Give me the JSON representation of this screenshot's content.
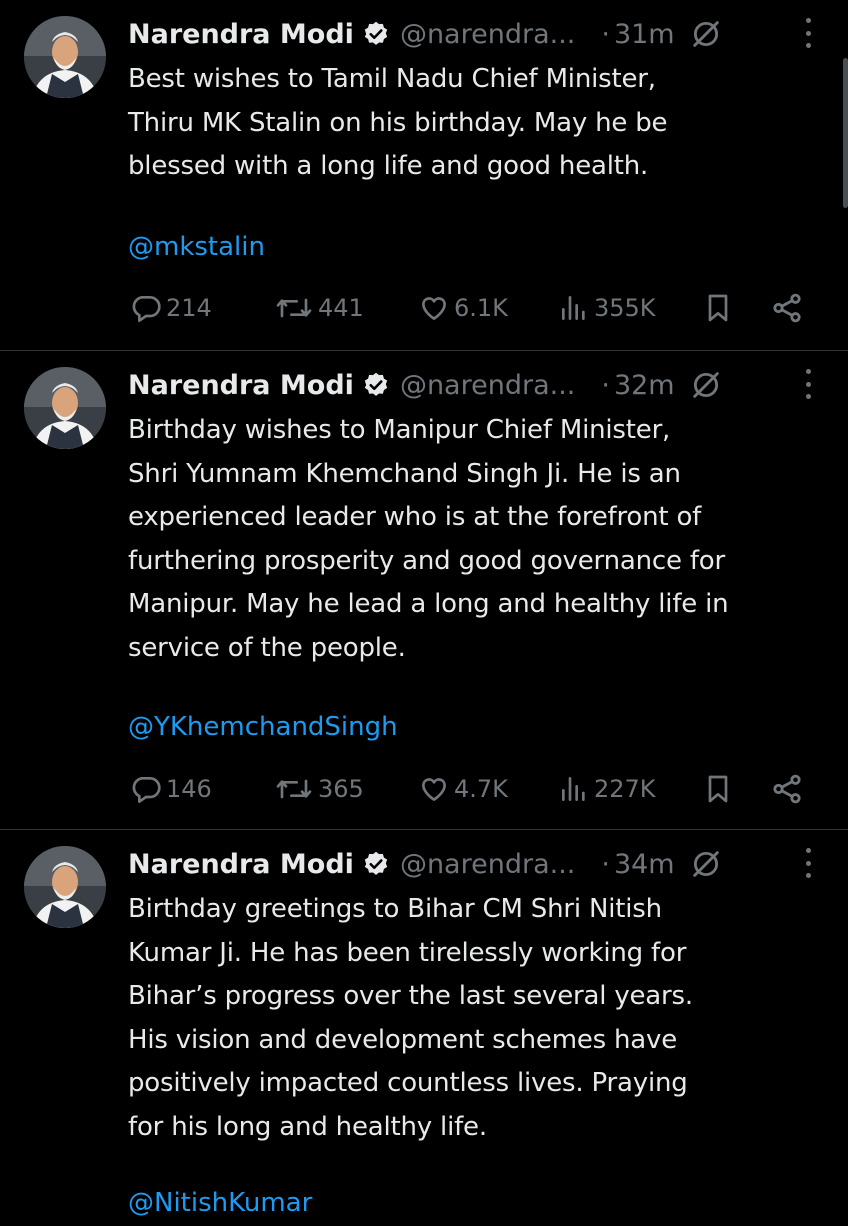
{
  "colors": {
    "background": "#000000",
    "text": "#e7e9ea",
    "muted": "#71767b",
    "link": "#1d9bf0",
    "verified": "#e7e9ea"
  },
  "tweets": [
    {
      "author": "Narendra Modi",
      "handle": "@narendra...",
      "dot": "·",
      "time": "31m",
      "lines": [
        "Best wishes to Tamil Nadu Chief Minister,",
        "Thiru MK Stalin on his birthday. May he be",
        "blessed with a long life and good health."
      ],
      "mention": "@mkstalin",
      "replies": "214",
      "reposts": "441",
      "likes": "6.1K",
      "views": "355K"
    },
    {
      "author": "Narendra Modi",
      "handle": "@narendra...",
      "dot": "·",
      "time": "32m",
      "lines": [
        "Birthday wishes to Manipur Chief Minister,",
        "Shri Yumnam Khemchand Singh Ji. He is an",
        "experienced leader who is at the forefront of",
        "furthering prosperity and good governance for",
        "Manipur. May he lead a long and healthy life in",
        "service of the people."
      ],
      "mention": "@YKhemchandSingh",
      "replies": "146",
      "reposts": "365",
      "likes": "4.7K",
      "views": "227K"
    },
    {
      "author": "Narendra Modi",
      "handle": "@narendra...",
      "dot": "·",
      "time": "34m",
      "lines": [
        "Birthday greetings to Bihar CM Shri Nitish",
        "Kumar Ji. He has been tirelessly working for",
        "Bihar’s progress over the last several years.",
        "His vision and development schemes have",
        "positively impacted countless lives. Praying",
        "for his long and healthy life."
      ],
      "mention": "@NitishKumar"
    }
  ],
  "icons": {
    "verified": "verified-badge-icon",
    "edited": "edited-icon",
    "more": "more-options-icon",
    "reply": "reply-icon",
    "repost": "repost-icon",
    "like": "like-icon",
    "views": "views-icon",
    "bookmark": "bookmark-icon",
    "share": "share-icon"
  }
}
